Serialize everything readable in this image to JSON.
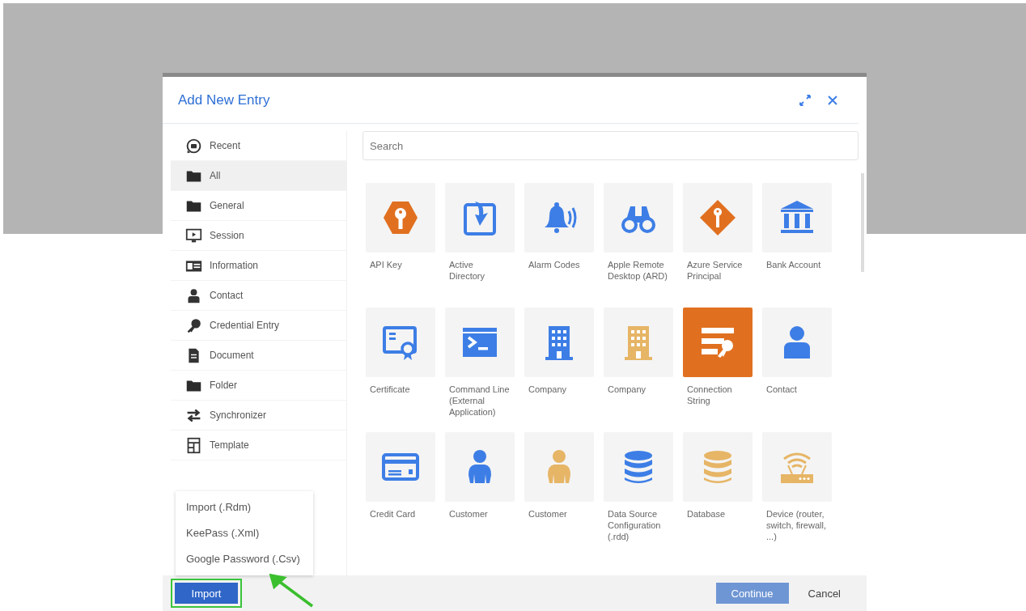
{
  "dialog": {
    "title": "Add New Entry"
  },
  "sidebar": {
    "items": [
      {
        "label": "Recent",
        "kind": "recent",
        "selected": false
      },
      {
        "label": "All",
        "kind": "folder",
        "selected": true
      },
      {
        "label": "General",
        "kind": "folder",
        "selected": false
      },
      {
        "label": "Session",
        "kind": "session",
        "selected": false
      },
      {
        "label": "Information",
        "kind": "information",
        "selected": false
      },
      {
        "label": "Contact",
        "kind": "contact",
        "selected": false
      },
      {
        "label": "Credential Entry",
        "kind": "key",
        "selected": false
      },
      {
        "label": "Document",
        "kind": "document",
        "selected": false
      },
      {
        "label": "Folder",
        "kind": "plainfolder",
        "selected": false
      },
      {
        "label": "Synchronizer",
        "kind": "sync",
        "selected": false
      },
      {
        "label": "Template",
        "kind": "template",
        "selected": false
      }
    ]
  },
  "search": {
    "placeholder": "Search"
  },
  "entries": [
    {
      "label": "API Key",
      "kind": "hexkey",
      "color": "#e07020",
      "selected": false
    },
    {
      "label": "Active Directory",
      "kind": "directory",
      "color": "#3d7ee6",
      "selected": false
    },
    {
      "label": "Alarm Codes",
      "kind": "bell",
      "color": "#3d7ee6",
      "selected": false
    },
    {
      "label": "Apple Remote Desktop (ARD)",
      "kind": "binoculars",
      "color": "#3d7ee6",
      "selected": false
    },
    {
      "label": "Azure Service Principal",
      "kind": "diamondkey",
      "color": "#e07020",
      "selected": false
    },
    {
      "label": "Bank Account",
      "kind": "bank",
      "color": "#3d7ee6",
      "selected": false
    },
    {
      "label": "Certificate",
      "kind": "certificate",
      "color": "#3d7ee6",
      "selected": false
    },
    {
      "label": "Command Line (External Application)",
      "kind": "terminal",
      "color": "#3d7ee6",
      "selected": false
    },
    {
      "label": "Company",
      "kind": "building",
      "color": "#3d7ee6",
      "selected": false
    },
    {
      "label": "Company",
      "kind": "building",
      "color": "#e6b566",
      "selected": false
    },
    {
      "label": "Connection String",
      "kind": "connstring",
      "color": "#e07020",
      "selected": true
    },
    {
      "label": "Contact",
      "kind": "bust",
      "color": "#3d7ee6",
      "selected": false
    },
    {
      "label": "Credit Card",
      "kind": "card",
      "color": "#3d7ee6",
      "selected": false
    },
    {
      "label": "Customer",
      "kind": "person",
      "color": "#3d7ee6",
      "selected": false
    },
    {
      "label": "Customer",
      "kind": "person",
      "color": "#e6b566",
      "selected": false
    },
    {
      "label": "Data Source Configuration (.rdd)",
      "kind": "database",
      "color": "#3d7ee6",
      "selected": false
    },
    {
      "label": "Database",
      "kind": "database",
      "color": "#e6b566",
      "selected": false
    },
    {
      "label": "Device (router, switch, firewall, ...)",
      "kind": "router",
      "color": "#e6b566",
      "selected": false
    }
  ],
  "import_menu": {
    "items": [
      "Import (.Rdm)",
      "KeePass (.Xml)",
      "Google Password (.Csv)"
    ]
  },
  "footer": {
    "import": "Import",
    "continue": {
      "label": "Continue",
      "disabled": true
    },
    "cancel": "Cancel"
  }
}
